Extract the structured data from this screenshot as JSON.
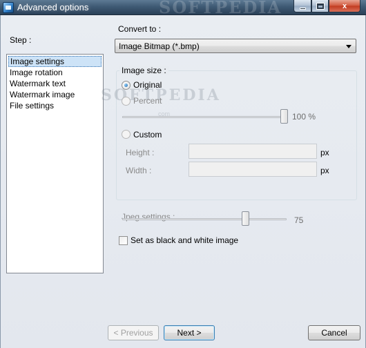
{
  "window": {
    "title": "Advanced options",
    "title_watermark": "SOFTPEDIA",
    "min_label": "",
    "max_label": "",
    "close_label": "x"
  },
  "steps": {
    "label": "Step :",
    "items": [
      {
        "label": "Image settings",
        "selected": true
      },
      {
        "label": "Image rotation"
      },
      {
        "label": "Watermark text"
      },
      {
        "label": "Watermark image"
      },
      {
        "label": "File settings"
      }
    ]
  },
  "convert": {
    "label": "Convert to :",
    "selected": "Image Bitmap (*.bmp)"
  },
  "image_size": {
    "title": "Image size :",
    "original_label": "Original",
    "percent_label": "Percent",
    "percent_value": "100 %",
    "percent_fraction": 1.0,
    "custom_label": "Custom",
    "height_label": "Height :",
    "width_label": "Width :",
    "height_unit": "px",
    "width_unit": "px",
    "selected": "original"
  },
  "jpeg": {
    "label": "Jpeg settings :",
    "value": "75",
    "fraction": 0.75
  },
  "bw_checkbox": {
    "label": "Set as black and white image",
    "checked": false
  },
  "buttons": {
    "previous": "< Previous",
    "next": "Next >",
    "cancel": "Cancel"
  },
  "watermark": {
    "text": "SOFTPEDIA",
    "small": "com"
  },
  "colors": {
    "selection": "#cde3f7",
    "titlebar": "#3f5a74",
    "close": "#c13a1f"
  }
}
